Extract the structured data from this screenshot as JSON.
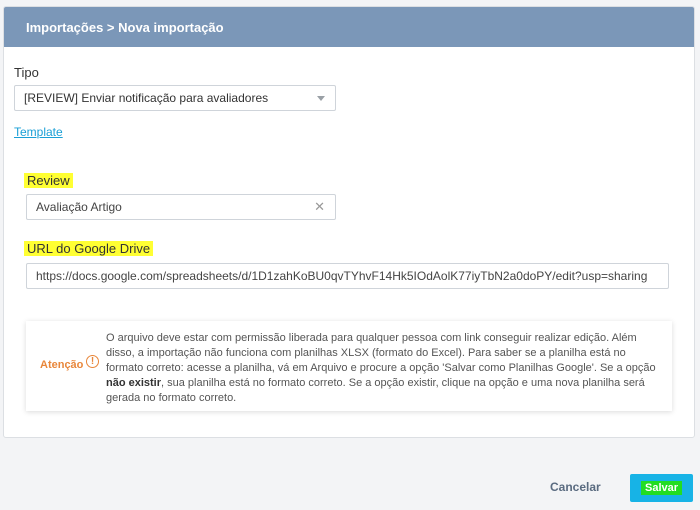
{
  "header": {
    "breadcrumb": "Importações > Nova importação"
  },
  "form": {
    "type_label": "Tipo",
    "type_value": "[REVIEW] Enviar notificação para avaliadores",
    "template_link": "Template",
    "review_label": "Review",
    "review_value": "Avaliação Artigo",
    "url_label": "URL do Google Drive",
    "url_value": "https://docs.google.com/spreadsheets/d/1D1zahKoBU0qvTYhvF14Hk5IOdAolK77iyTbN2a0doPY/edit?usp=sharing"
  },
  "alert": {
    "label": "Atenção",
    "text_part1": "O arquivo deve estar com permissão liberada para qualquer pessoa com link conseguir realizar edição. Além disso, a importação não funciona com planilhas XLSX (formato do Excel). Para saber se a planilha está no formato correto: acesse a planilha, vá em Arquivo e procure a opção 'Salvar como Planilhas Google'. Se a opção ",
    "text_bold": "não existir",
    "text_part2": ", sua planilha está no formato correto. Se a opção existir, clique na opção e uma nova planilha será gerada no formato correto."
  },
  "actions": {
    "cancel": "Cancelar",
    "save": "Salvar"
  },
  "colors": {
    "header_bg": "#7b97b8",
    "primary": "#17b3e6",
    "warning": "#e8863a",
    "highlight": "#ffff33"
  }
}
